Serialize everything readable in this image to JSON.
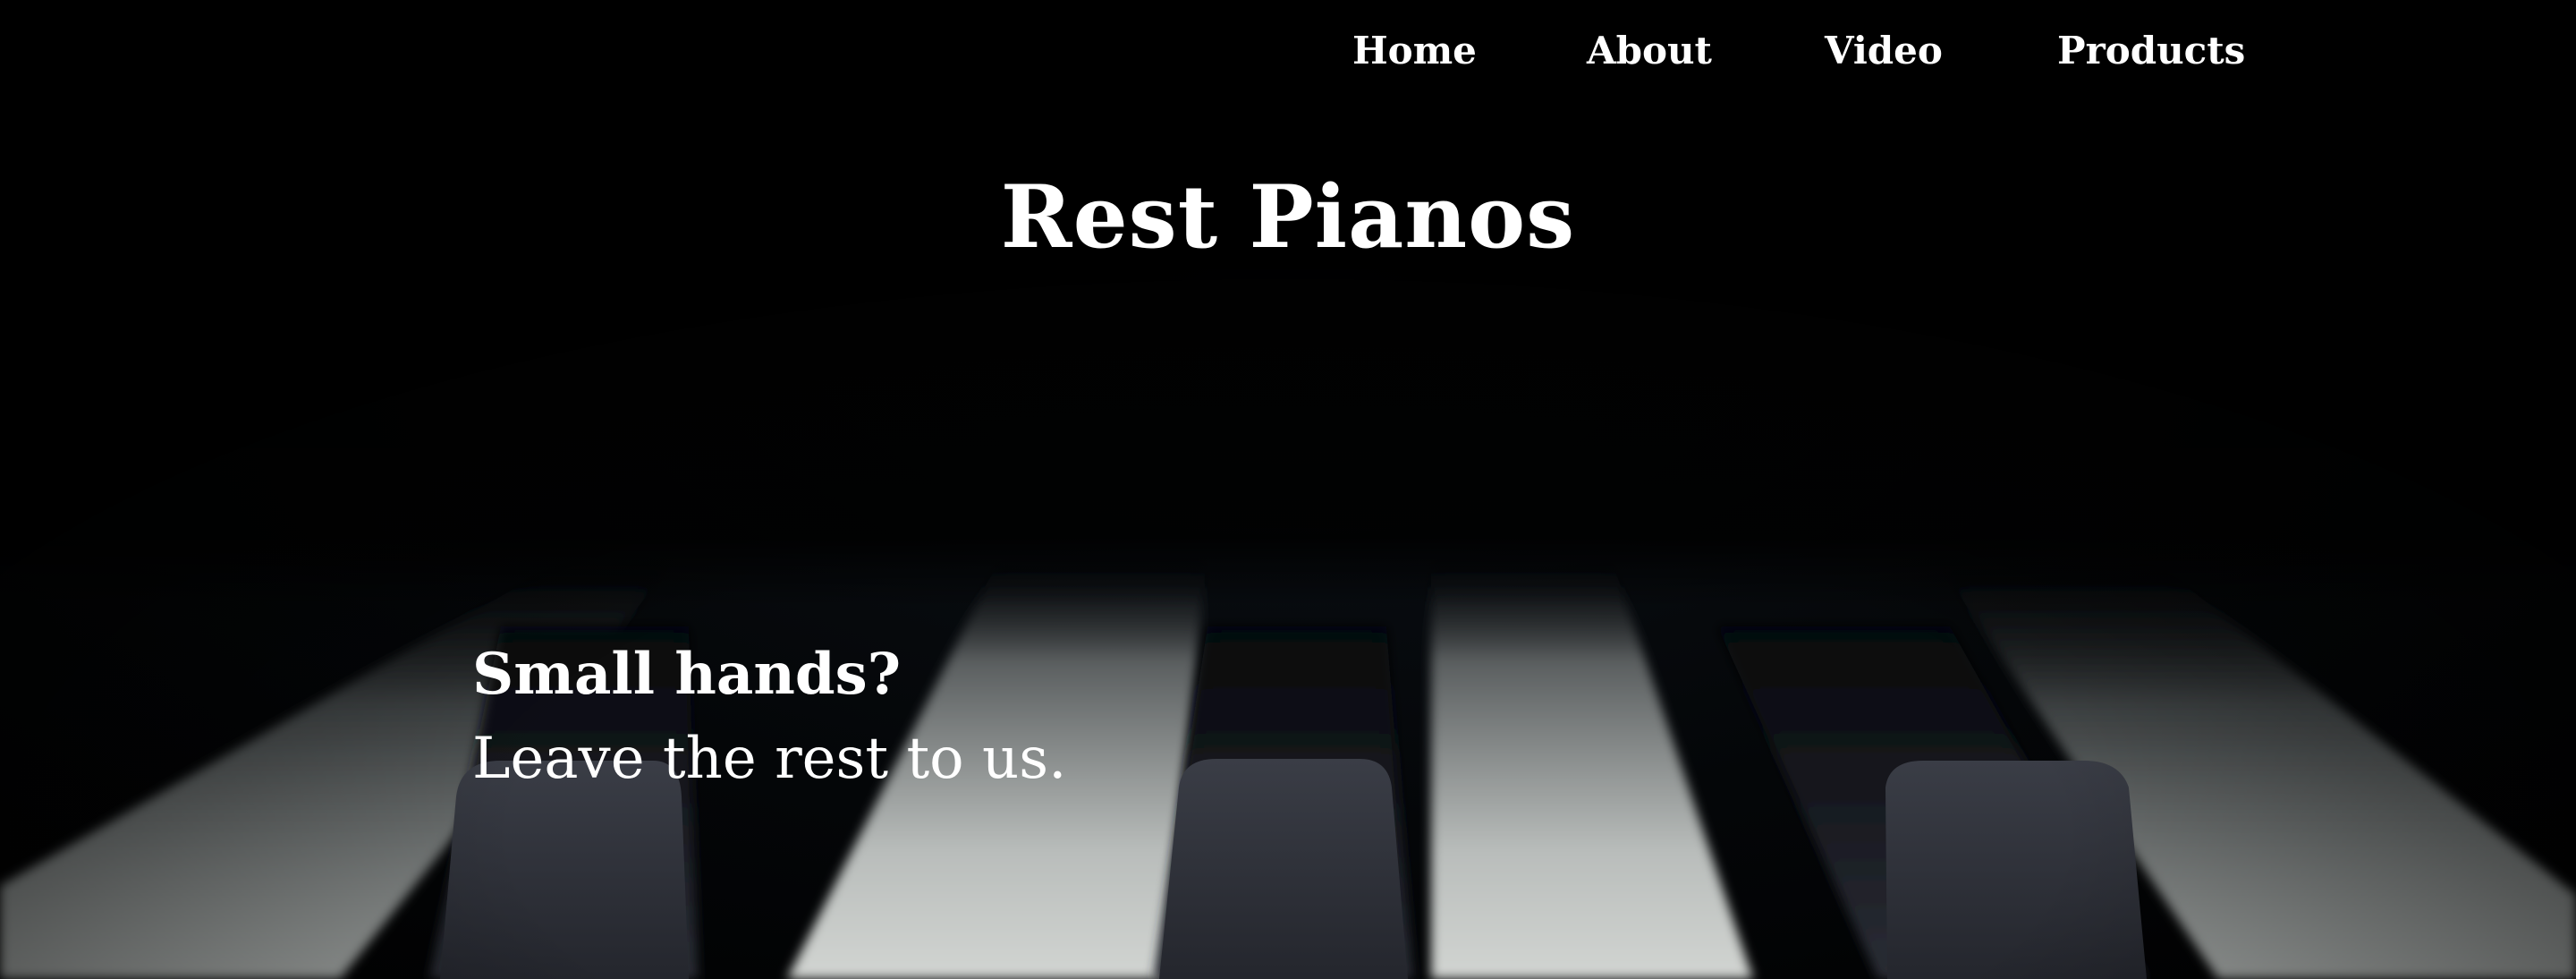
{
  "nav": {
    "items": [
      {
        "label": "Home"
      },
      {
        "label": "About"
      },
      {
        "label": "Video"
      },
      {
        "label": "Products"
      }
    ]
  },
  "header": {
    "title": "Rest Pianos"
  },
  "hero": {
    "heading": "Small hands?",
    "subheading": "Leave the rest to us.",
    "background_image": "piano-keys-closeup"
  },
  "colors": {
    "background": "#000000",
    "text": "#ffffff",
    "white_key": "#c9ccc9",
    "black_key": "#1a1c22"
  }
}
